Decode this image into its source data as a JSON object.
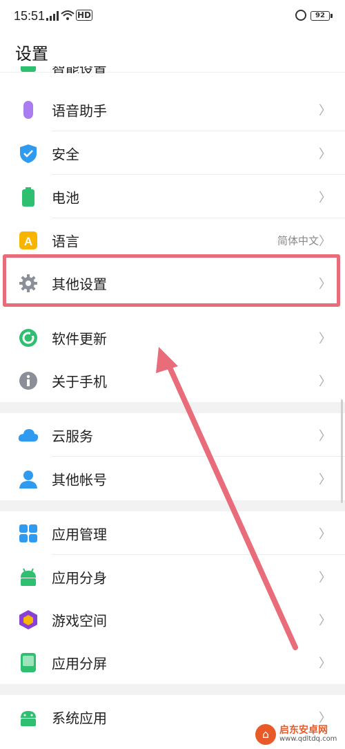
{
  "status_bar": {
    "time": "15:51",
    "network": "HD",
    "battery": "92"
  },
  "header": {
    "title": "设置"
  },
  "partial_item": {
    "label": "智能设置"
  },
  "items": [
    {
      "label": "语音助手",
      "value": ""
    },
    {
      "label": "安全",
      "value": ""
    },
    {
      "label": "电池",
      "value": ""
    },
    {
      "label": "语言",
      "value": "简体中文"
    },
    {
      "label": "其他设置",
      "value": ""
    },
    {
      "label": "软件更新",
      "value": ""
    },
    {
      "label": "关于手机",
      "value": ""
    },
    {
      "label": "云服务",
      "value": ""
    },
    {
      "label": "其他帐号",
      "value": ""
    },
    {
      "label": "应用管理",
      "value": ""
    },
    {
      "label": "应用分身",
      "value": ""
    },
    {
      "label": "游戏空间",
      "value": ""
    },
    {
      "label": "应用分屏",
      "value": ""
    },
    {
      "label": "系统应用",
      "value": ""
    }
  ],
  "chevron": "〉",
  "colors": {
    "annotation": "#e96c7a",
    "accent_blue": "#2e9bf0",
    "accent_green": "#2fbf71"
  },
  "watermark": {
    "name": "启东安卓网",
    "url": "www.qdltdq.com",
    "logo": "⌂"
  }
}
